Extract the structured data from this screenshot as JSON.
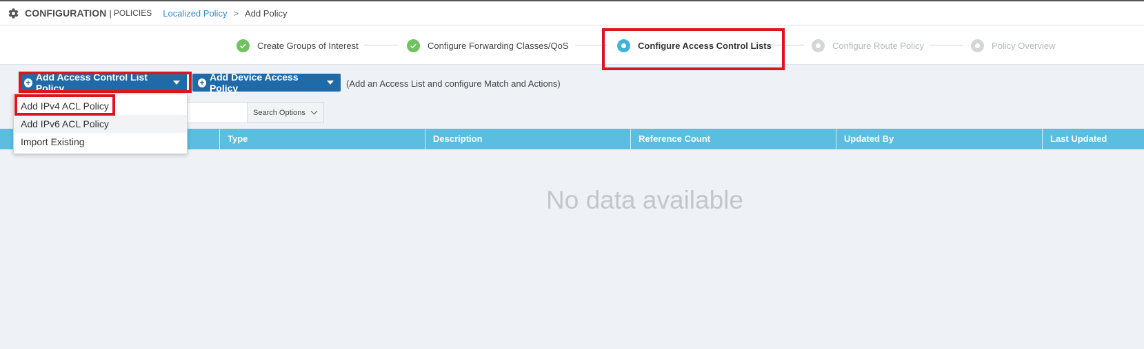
{
  "header": {
    "section": "CONFIGURATION",
    "separator": "|",
    "subsection": "POLICIES",
    "breadcrumb_link": "Localized Policy",
    "breadcrumb_arrow": ">",
    "breadcrumb_current": "Add Policy"
  },
  "stepper": {
    "steps": [
      {
        "label": "Create Groups of Interest",
        "state": "done"
      },
      {
        "label": "Configure Forwarding Classes/QoS",
        "state": "done"
      },
      {
        "label": "Configure Access Control Lists",
        "state": "active"
      },
      {
        "label": "Configure Route Policy",
        "state": "future"
      },
      {
        "label": "Policy Overview",
        "state": "future"
      }
    ]
  },
  "toolbar": {
    "add_acl_label": "Add Access Control List Policy",
    "add_device_label": "Add Device Access Policy",
    "hint": "(Add an Access List and configure Match and Actions)"
  },
  "dropdown": {
    "items": [
      "Add IPv4 ACL Policy",
      "Add IPv6 ACL Policy",
      "Import Existing"
    ]
  },
  "search": {
    "placeholder": "",
    "options_label": "Search Options"
  },
  "table": {
    "columns": [
      "Type",
      "Description",
      "Reference Count",
      "Updated By",
      "Last Updated"
    ],
    "empty_message": "No data available"
  },
  "colors": {
    "primary_button": "#1f6aa8",
    "table_header": "#5bbde0",
    "step_done": "#6fc25f",
    "step_active": "#3fb3d9",
    "highlight": "#e0141e",
    "link": "#2e8ccf"
  },
  "icons": {
    "header": "gear-icon",
    "step_done": "checkmark-icon",
    "step_active": "radio-dot-icon",
    "button": "plus-circle-icon",
    "dropdown": "caret-down-icon"
  }
}
